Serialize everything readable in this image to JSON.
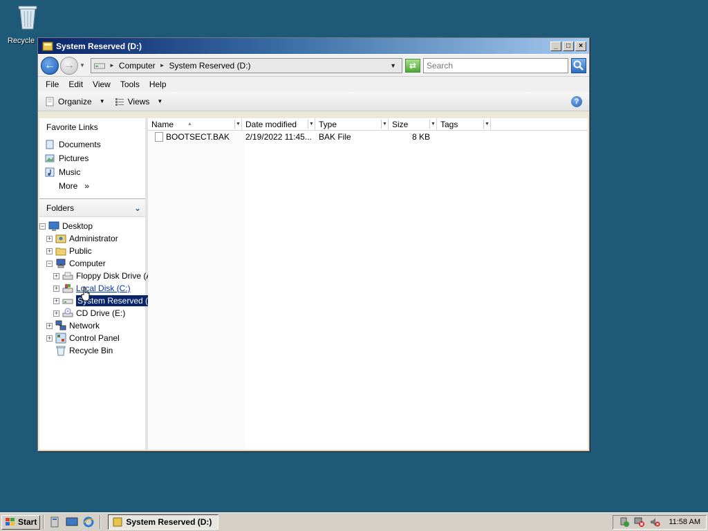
{
  "desktop": {
    "recycle_bin_label": "Recycle Bin"
  },
  "window": {
    "title": "System Reserved (D:)",
    "title_buttons": {
      "minimize": "_",
      "maximize": "□",
      "close": "×"
    },
    "address": {
      "crumbs": [
        "Computer",
        "System Reserved (D:)"
      ]
    },
    "search": {
      "placeholder": "Search"
    },
    "menu": [
      "File",
      "Edit",
      "View",
      "Tools",
      "Help"
    ],
    "toolbar": {
      "organize": "Organize",
      "views": "Views",
      "help": "?"
    },
    "favorites": {
      "header": "Favorite Links",
      "items": [
        {
          "label": "Documents",
          "icon": "documents-icon"
        },
        {
          "label": "Pictures",
          "icon": "pictures-icon"
        },
        {
          "label": "Music",
          "icon": "music-icon"
        }
      ],
      "more": "More",
      "more_chevron": "»"
    },
    "folders": {
      "header": "Folders",
      "tree": [
        {
          "label": "Desktop",
          "expander": "−",
          "icon": "desktop-icon"
        },
        {
          "label": "Administrator",
          "expander": "+",
          "icon": "user-folder-icon"
        },
        {
          "label": "Public",
          "expander": "+",
          "icon": "folder-icon"
        },
        {
          "label": "Computer",
          "expander": "−",
          "icon": "computer-icon"
        },
        {
          "label": "Floppy Disk Drive (A:)",
          "expander": "+",
          "icon": "floppy-drive-icon"
        },
        {
          "label": "Local Disk (C:)",
          "expander": "+",
          "icon": "local-disk-icon"
        },
        {
          "label": "System Reserved (D:)",
          "expander": "+",
          "icon": "drive-icon"
        },
        {
          "label": "CD Drive (E:)",
          "expander": "+",
          "icon": "cd-drive-icon"
        },
        {
          "label": "Network",
          "expander": "+",
          "icon": "network-icon"
        },
        {
          "label": "Control Panel",
          "expander": "+",
          "icon": "control-panel-icon"
        },
        {
          "label": "Recycle Bin",
          "expander": "",
          "icon": "recycle-bin-icon"
        }
      ]
    },
    "columns": [
      "Name",
      "Date modified",
      "Type",
      "Size",
      "Tags"
    ],
    "files": [
      {
        "name": "BOOTSECT.BAK",
        "date_modified": "2/19/2022 11:45...",
        "type": "BAK File",
        "size": "8 KB",
        "tags": ""
      }
    ]
  },
  "taskbar": {
    "start": "Start",
    "active_task": "System Reserved (D:)",
    "clock": "11:58 AM"
  },
  "colors": {
    "desktop": "#1e5a78",
    "title_start": "#0a246a",
    "title_end": "#a6caf0",
    "selection": "#0a246a",
    "link": "#0033aa"
  }
}
